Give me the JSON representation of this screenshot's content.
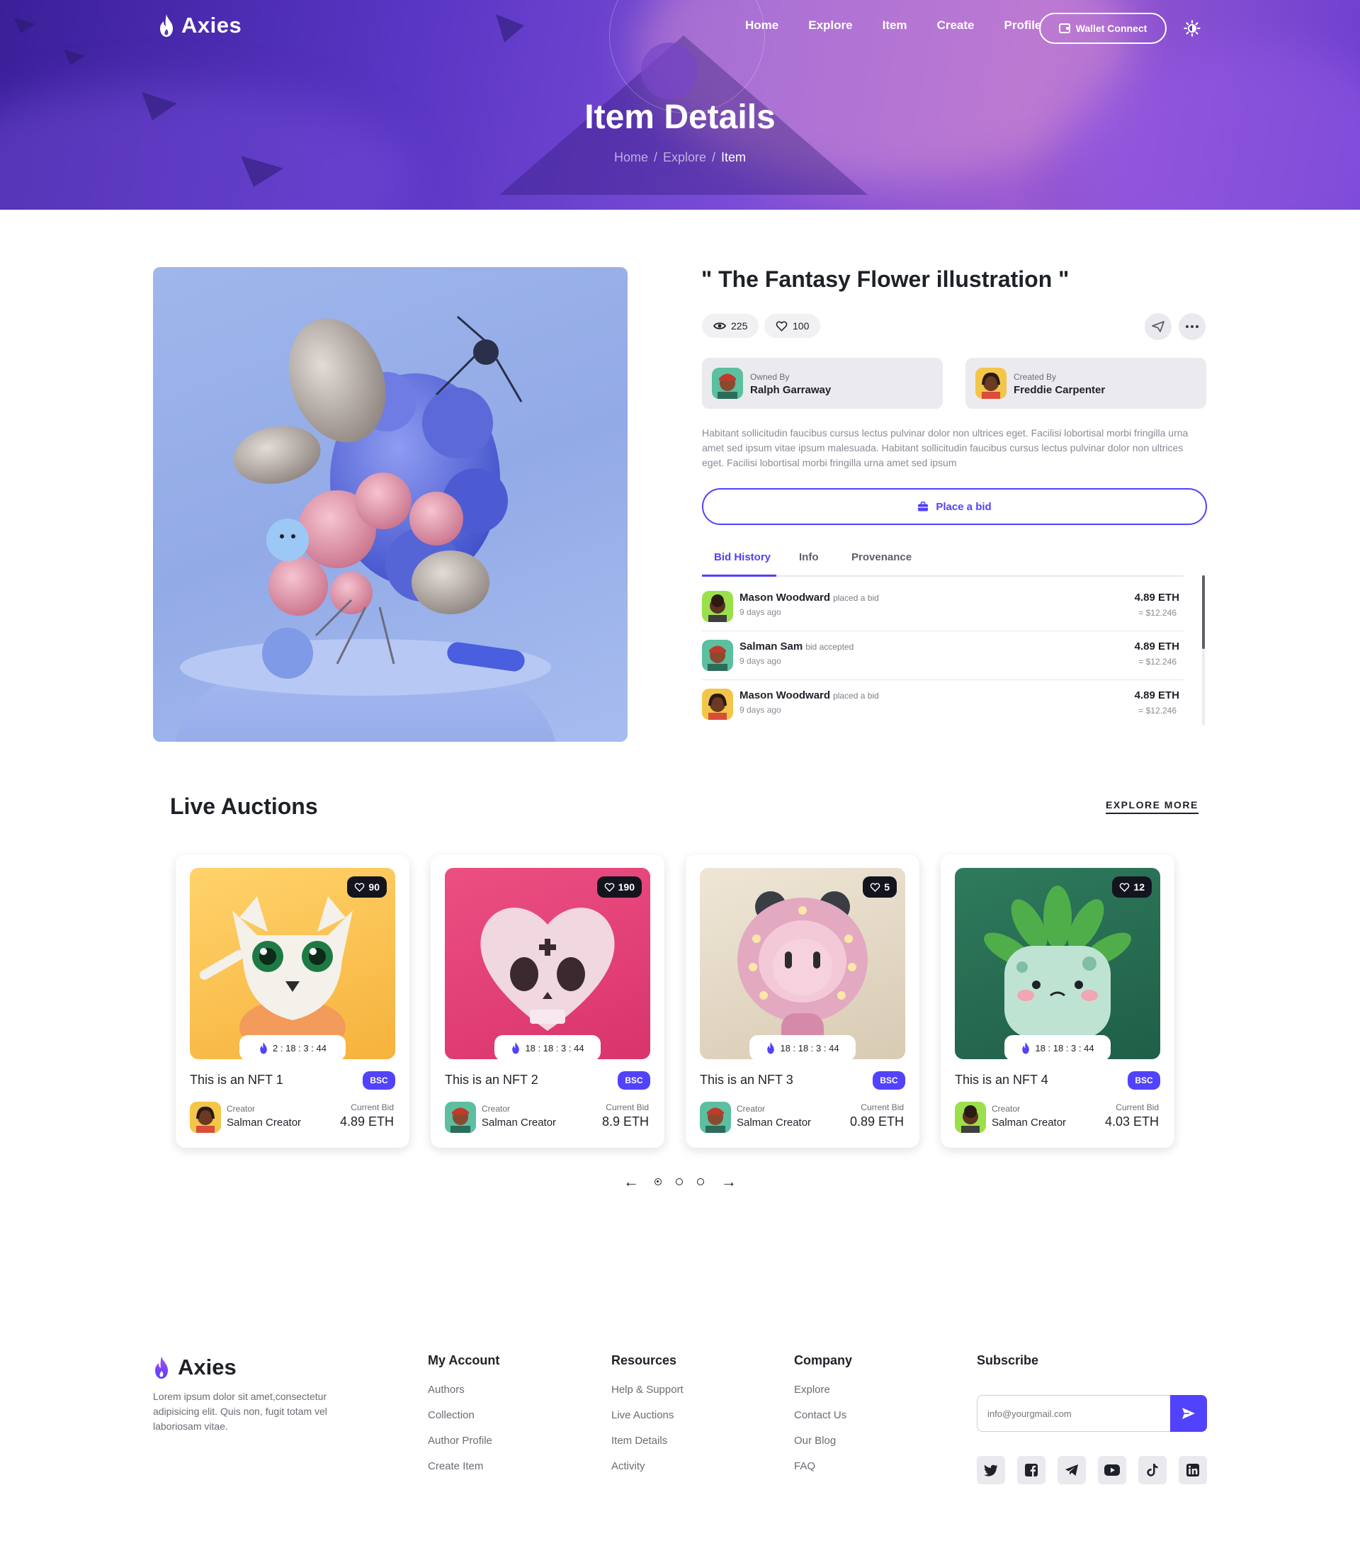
{
  "nav": {
    "brand": "Axies",
    "links": [
      "Home",
      "Explore",
      "Item",
      "Create",
      "Profile"
    ],
    "wallet_label": "Wallet Connect"
  },
  "hero": {
    "title": "Item Details",
    "breadcrumb": [
      "Home",
      "Explore",
      "Item"
    ],
    "breadcrumb_separator": "/"
  },
  "item": {
    "title": "\" The Fantasy Flower illustration \"",
    "views": "225",
    "likes": "100",
    "owner": {
      "label": "Owned By",
      "name": "Ralph Garraway"
    },
    "creator": {
      "label": "Created By",
      "name": "Freddie Carpenter"
    },
    "description": "Habitant sollicitudin faucibus cursus lectus pulvinar dolor non ultrices eget. Facilisi lobortisal morbi fringilla urna amet sed ipsum vitae ipsum malesuada. Habitant sollicitudin faucibus cursus lectus pulvinar dolor non ultrices eget. Facilisi lobortisal morbi fringilla urna amet sed ipsum",
    "bid_button": "Place a bid",
    "tabs": [
      "Bid History",
      "Info",
      "Provenance"
    ],
    "bids": [
      {
        "name": "Mason Woodward",
        "action": "placed a bid",
        "time": "9 days ago",
        "eth": "4.89 ETH",
        "usd": "= $12.246"
      },
      {
        "name": "Salman Sam",
        "action": "bid accepted",
        "time": "9 days ago",
        "eth": "4.89 ETH",
        "usd": "= $12.246"
      },
      {
        "name": "Mason Woodward",
        "action": "placed a bid",
        "time": "9 days ago",
        "eth": "4.89 ETH",
        "usd": "= $12.246"
      }
    ]
  },
  "auctions": {
    "title": "Live Auctions",
    "explore_more": "EXPLORE MORE",
    "cards": [
      {
        "name": "This is an NFT 1",
        "likes": "90",
        "timer": "2 : 18 : 3 : 44",
        "chain": "BSC",
        "creator_label": "Creator",
        "creator": "Salman Creator",
        "bid_label": "Current Bid",
        "bid": "4.89 ETH"
      },
      {
        "name": "This is an NFT 2",
        "likes": "190",
        "timer": "18 : 18 : 3 : 44",
        "chain": "BSC",
        "creator_label": "Creator",
        "creator": "Salman Creator",
        "bid_label": "Current Bid",
        "bid": "8.9 ETH"
      },
      {
        "name": "This is an NFT 3",
        "likes": "5",
        "timer": "18 : 18 : 3 : 44",
        "chain": "BSC",
        "creator_label": "Creator",
        "creator": "Salman Creator",
        "bid_label": "Current Bid",
        "bid": "0.89 ETH"
      },
      {
        "name": "This is an NFT 4",
        "likes": "12",
        "timer": "18 : 18 : 3 : 44",
        "chain": "BSC",
        "creator_label": "Creator",
        "creator": "Salman Creator",
        "bid_label": "Current Bid",
        "bid": "4.03 ETH"
      }
    ],
    "pager_active": 1
  },
  "footer": {
    "brand": "Axies",
    "about": "Lorem ipsum dolor sit amet,consectetur adipisicing elit. Quis non, fugit totam vel laboriosam vitae.",
    "my_account": {
      "title": "My Account",
      "links": [
        "Authors",
        "Collection",
        "Author Profile",
        "Create Item"
      ]
    },
    "resources": {
      "title": "Resources",
      "links": [
        "Help & Support",
        "Live Auctions",
        "Item Details",
        "Activity"
      ]
    },
    "company": {
      "title": "Company",
      "links": [
        "Explore",
        "Contact Us",
        "Our Blog",
        "FAQ"
      ]
    },
    "subscribe": {
      "title": "Subscribe",
      "placeholder": "info@yourgmail.com"
    },
    "socials": [
      "twitter-icon",
      "facebook-icon",
      "telegram-icon",
      "youtube-icon",
      "tiktok-icon",
      "linkedin-icon"
    ]
  },
  "colors": {
    "accent": "#5142fc",
    "dark": "#1f2128",
    "muted": "#8a8a95"
  }
}
